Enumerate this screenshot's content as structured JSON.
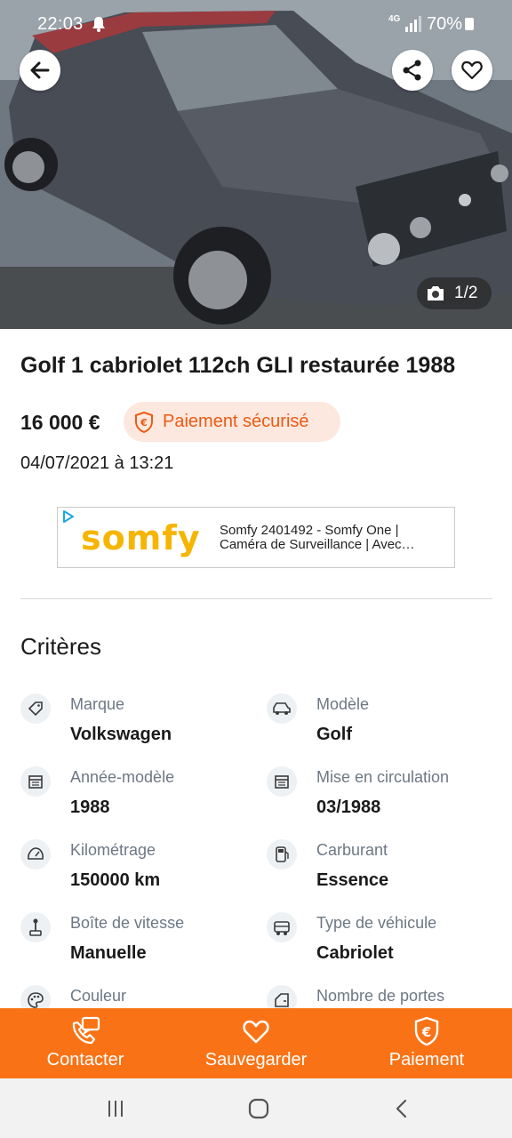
{
  "status_bar": {
    "time": "22:03",
    "network": "4G",
    "battery": "70%"
  },
  "hero": {
    "photo_counter": "1/2",
    "icons": {
      "back": "arrow-left-icon",
      "share": "share-icon",
      "favorite": "heart-icon",
      "camera": "camera-icon"
    }
  },
  "listing": {
    "title": "Golf 1 cabriolet 112ch GLI restaurée 1988",
    "price": "16 000 €",
    "secure_payment_label": "Paiement sécurisé",
    "date": "04/07/2021 à 13:21"
  },
  "ad": {
    "brand": "somfy",
    "text": "Somfy 2401492 - Somfy One | Caméra de Surveillance | Avec…"
  },
  "criteria": {
    "title": "Critères",
    "items": [
      {
        "label": "Marque",
        "value": "Volkswagen",
        "icon": "tag-icon"
      },
      {
        "label": "Modèle",
        "value": "Golf",
        "icon": "car-icon"
      },
      {
        "label": "Année-modèle",
        "value": "1988",
        "icon": "calendar-icon"
      },
      {
        "label": "Mise en circulation",
        "value": "03/1988",
        "icon": "calendar-icon"
      },
      {
        "label": "Kilométrage",
        "value": "150000 km",
        "icon": "speedometer-icon"
      },
      {
        "label": "Carburant",
        "value": "Essence",
        "icon": "fuel-pump-icon"
      },
      {
        "label": "Boîte de vitesse",
        "value": "Manuelle",
        "icon": "gear-stick-icon"
      },
      {
        "label": "Type de véhicule",
        "value": "Cabriolet",
        "icon": "vehicle-type-icon"
      },
      {
        "label": "Couleur",
        "value": "",
        "icon": "palette-icon"
      },
      {
        "label": "Nombre de portes",
        "value": "",
        "icon": "car-door-icon"
      }
    ]
  },
  "actions": [
    {
      "label": "Contacter",
      "icon": "contact-icon"
    },
    {
      "label": "Sauvegarder",
      "icon": "heart-icon"
    },
    {
      "label": "Paiement",
      "icon": "euro-shield-icon"
    }
  ],
  "colors": {
    "accent": "#f97316",
    "badge_bg": "#fde8df",
    "badge_text": "#ec5a13"
  }
}
